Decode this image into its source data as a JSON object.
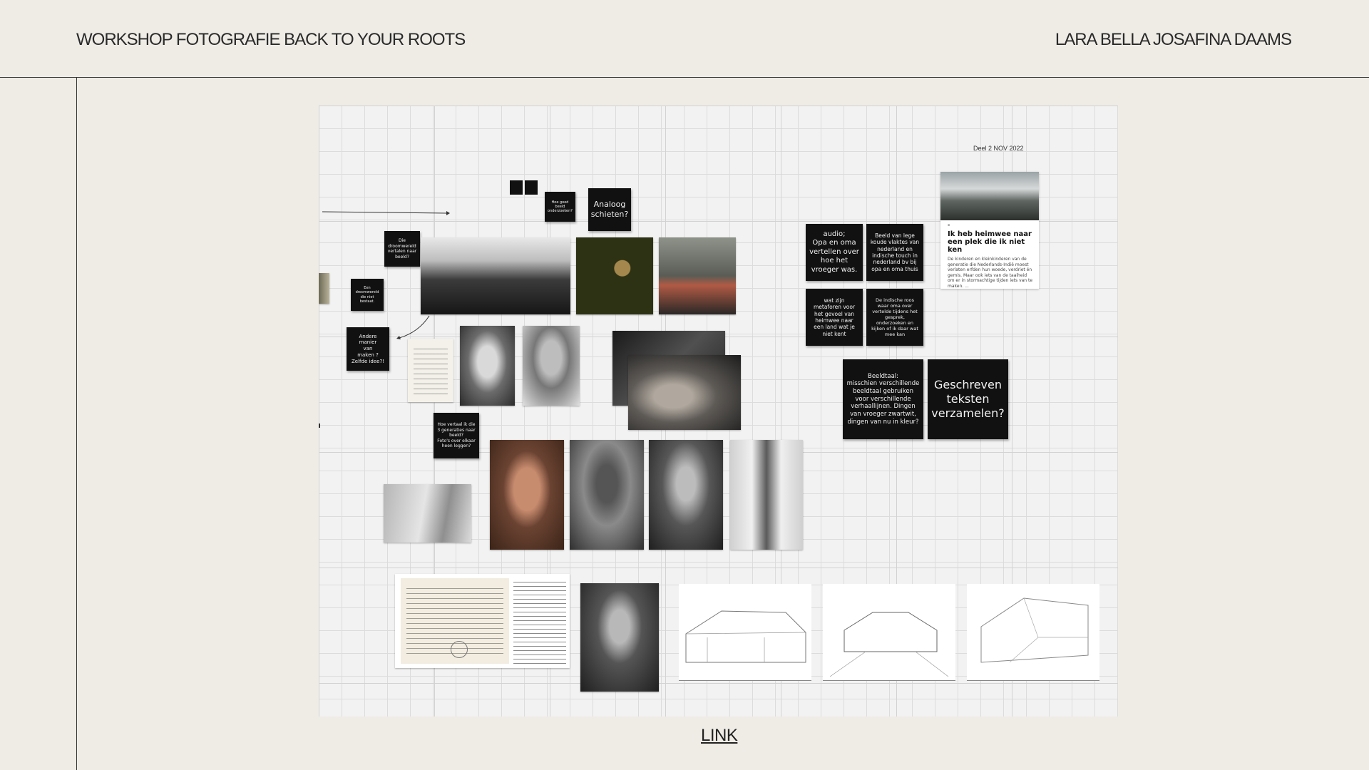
{
  "header": {
    "title_left": "WORKSHOP FOTOGRAFIE BACK TO YOUR ROOTS",
    "title_right": "LARA BELLA JOSAFINA DAAMS"
  },
  "board": {
    "date_label": "Deel 2 NOV 2022",
    "notes": {
      "hoe_goed": "Hoe goed\nbeeld\nonderzoeken?",
      "analoog": "Analoog\nschieten?",
      "droomwereld": "Die\ndroomwereld\nvertalen naar\nbeeld?",
      "een_droomwereld": "Een\ndroomwereld\ndie niet\nbestaat.",
      "andere_manier": "Andere\nmanier\nvan\nmaken ?\nZelfde idee?!",
      "hoe_vertaal": "Hoe vertaal ik die\n3 generaties naar\nbeeld?\nFoto's over elkaar\nheen leggen?",
      "audio": "audio;\nOpa en oma\nvertellen over\nhoe het\nvroeger was.",
      "beeld_lege": "Beeld van lege\nkoude vlaktes van\nnederland en\nindische touch in\nnederland bv bij\nopa en oma thuis",
      "metaforen": "wat zijn\nmetaforen voor\nhet gevoel van\nheimwee naar\neen land wat je\nniet kent",
      "indische_roos": "De indische roos\nwaar oma over\nvertelde tijdens het\ngesprek,\nonderzoeken en\nkijken of ik daar wat\nmee kan",
      "beeldtaal": "Beeldtaal:\nmisschien verschillende\nbeeldtaal gebruiken\nvoor verschillende\nverhaallijnen. Dingen\nvan vroeger zwartwit,\ndingen van nu in kleur?",
      "geschreven": "Geschreven\nteksten\nverzamelen?"
    },
    "article": {
      "headline": "Ik heb heimwee naar een plek die ik niet ken",
      "lead": "De kinderen en kleinkinderen van de generatie die Nederlands-Indië moest verlaten erfden hun woede, verdriet én gemis. Maar ook iets van de taaiheid om er in stormachtige tijden iets van te maken. ..."
    }
  },
  "footer": {
    "link_label": "LINK"
  },
  "colors": {
    "background": "#efece6",
    "board": "#f2f2f2",
    "note": "#111111",
    "text": "#222222"
  }
}
